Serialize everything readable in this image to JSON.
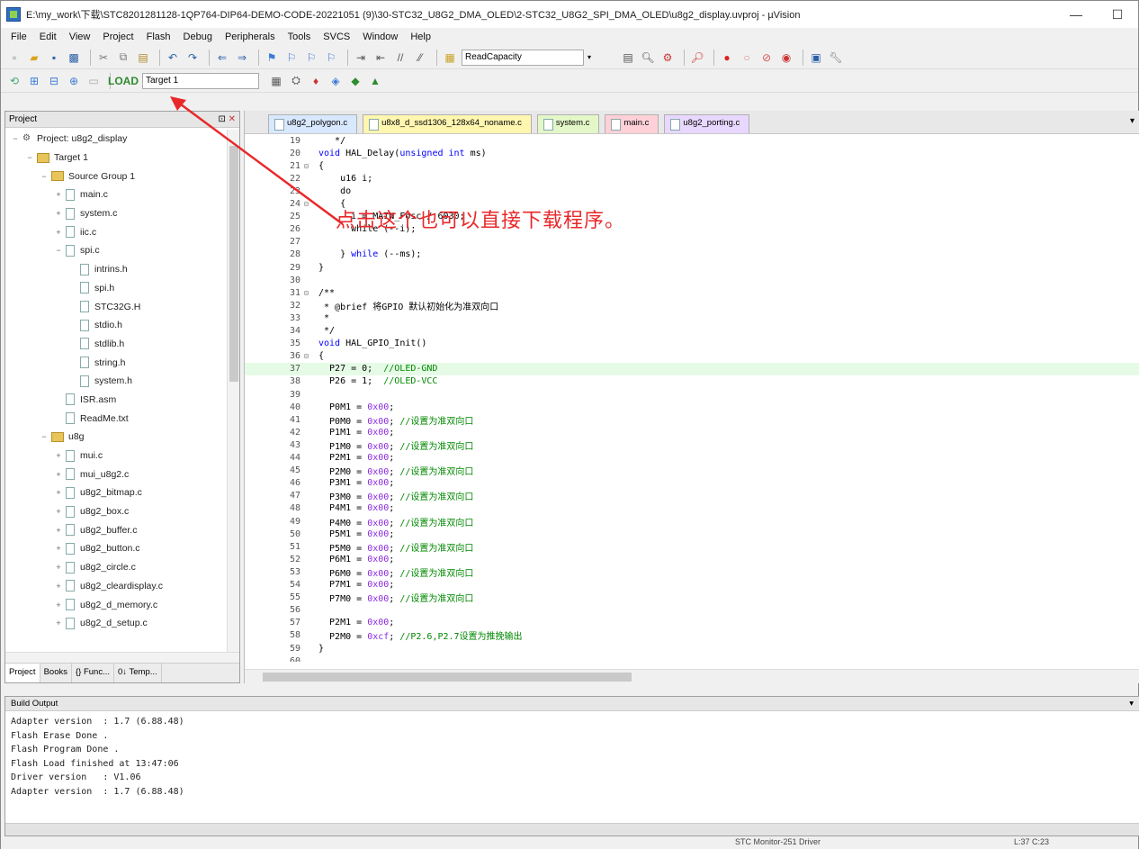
{
  "window": {
    "title": "E:\\my_work\\下载\\STC8201281128-1QP764-DIP64-DEMO-CODE-20221051 (9)\\30-STC32_U8G2_DMA_OLED\\2-STC32_U8G2_SPI_DMA_OLED\\u8g2_display.uvproj - µVision",
    "minimize": "—",
    "maximize": "☐"
  },
  "menu": [
    "File",
    "Edit",
    "View",
    "Project",
    "Flash",
    "Debug",
    "Peripherals",
    "Tools",
    "SVCS",
    "Window",
    "Help"
  ],
  "toolbar": {
    "find_combo": "ReadCapacity",
    "target_combo": "Target 1"
  },
  "project": {
    "header": "Project",
    "tree": [
      {
        "depth": 0,
        "exp": "−",
        "icon": "proj",
        "label": "Project: u8g2_display"
      },
      {
        "depth": 1,
        "exp": "−",
        "icon": "folder",
        "label": "Target 1"
      },
      {
        "depth": 2,
        "exp": "−",
        "icon": "folder",
        "label": "Source Group 1"
      },
      {
        "depth": 3,
        "exp": "+",
        "icon": "file",
        "label": "main.c"
      },
      {
        "depth": 3,
        "exp": "+",
        "icon": "file",
        "label": "system.c"
      },
      {
        "depth": 3,
        "exp": "+",
        "icon": "file",
        "label": "iic.c"
      },
      {
        "depth": 3,
        "exp": "−",
        "icon": "file",
        "label": "spi.c"
      },
      {
        "depth": 4,
        "exp": "",
        "icon": "file",
        "label": "intrins.h"
      },
      {
        "depth": 4,
        "exp": "",
        "icon": "file",
        "label": "spi.h"
      },
      {
        "depth": 4,
        "exp": "",
        "icon": "file",
        "label": "STC32G.H"
      },
      {
        "depth": 4,
        "exp": "",
        "icon": "file",
        "label": "stdio.h"
      },
      {
        "depth": 4,
        "exp": "",
        "icon": "file",
        "label": "stdlib.h"
      },
      {
        "depth": 4,
        "exp": "",
        "icon": "file",
        "label": "string.h"
      },
      {
        "depth": 4,
        "exp": "",
        "icon": "file",
        "label": "system.h"
      },
      {
        "depth": 3,
        "exp": "",
        "icon": "file",
        "label": "ISR.asm"
      },
      {
        "depth": 3,
        "exp": "",
        "icon": "file",
        "label": "ReadMe.txt"
      },
      {
        "depth": 2,
        "exp": "−",
        "icon": "folder",
        "label": "u8g"
      },
      {
        "depth": 3,
        "exp": "+",
        "icon": "file",
        "label": "mui.c"
      },
      {
        "depth": 3,
        "exp": "+",
        "icon": "file",
        "label": "mui_u8g2.c"
      },
      {
        "depth": 3,
        "exp": "+",
        "icon": "file",
        "label": "u8g2_bitmap.c"
      },
      {
        "depth": 3,
        "exp": "+",
        "icon": "file",
        "label": "u8g2_box.c"
      },
      {
        "depth": 3,
        "exp": "+",
        "icon": "file",
        "label": "u8g2_buffer.c"
      },
      {
        "depth": 3,
        "exp": "+",
        "icon": "file",
        "label": "u8g2_button.c"
      },
      {
        "depth": 3,
        "exp": "+",
        "icon": "file",
        "label": "u8g2_circle.c"
      },
      {
        "depth": 3,
        "exp": "+",
        "icon": "file",
        "label": "u8g2_cleardisplay.c"
      },
      {
        "depth": 3,
        "exp": "+",
        "icon": "file",
        "label": "u8g2_d_memory.c"
      },
      {
        "depth": 3,
        "exp": "+",
        "icon": "file",
        "label": "u8g2_d_setup.c"
      }
    ],
    "tabs": [
      "Project",
      "Books",
      "{} Func...",
      "0↓ Temp..."
    ]
  },
  "editor": {
    "tabs": [
      {
        "label": "u8g2_polygon.c",
        "color": "#d8e8ff"
      },
      {
        "label": "u8x8_d_ssd1306_128x64_noname.c",
        "color": "#fff6b0"
      },
      {
        "label": "system.c",
        "color": "#e4f7c8"
      },
      {
        "label": "main.c",
        "color": "#ffd0d8"
      },
      {
        "label": "u8g2_porting.c",
        "color": "#e8d8ff"
      }
    ],
    "lines": [
      {
        "n": "19",
        "fold": "",
        "html": "   */"
      },
      {
        "n": "20",
        "fold": "",
        "html": "<span class='kw'>void</span> HAL_Delay(<span class='kw'>unsigned int</span> ms)"
      },
      {
        "n": "21",
        "fold": "⊟",
        "html": "{"
      },
      {
        "n": "22",
        "fold": "",
        "html": "    u16 i;"
      },
      {
        "n": "23",
        "fold": "",
        "html": "    do"
      },
      {
        "n": "24",
        "fold": "⊟",
        "html": "    {"
      },
      {
        "n": "25",
        "fold": "",
        "html": "      i = MAIN_Fosc / 6030;"
      },
      {
        "n": "26",
        "fold": "",
        "html": "      while (--i);"
      },
      {
        "n": "27",
        "fold": "",
        "html": ""
      },
      {
        "n": "28",
        "fold": "",
        "html": "    } <span class='kw'>while</span> (--ms);"
      },
      {
        "n": "29",
        "fold": "",
        "html": "}"
      },
      {
        "n": "30",
        "fold": "",
        "html": ""
      },
      {
        "n": "31",
        "fold": "⊟",
        "html": "/**"
      },
      {
        "n": "32",
        "fold": "",
        "html": " * @brief 将GPIO 默认初始化为准双向口"
      },
      {
        "n": "33",
        "fold": "",
        "html": " *"
      },
      {
        "n": "34",
        "fold": "",
        "html": " */"
      },
      {
        "n": "35",
        "fold": "",
        "html": "<span class='kw'>void</span> HAL_GPIO_Init()"
      },
      {
        "n": "36",
        "fold": "⊟",
        "html": "{"
      },
      {
        "n": "37",
        "fold": "",
        "html": "  P27 = 0;  <span class='cm'>//OLED-GND</span>",
        "hl": true
      },
      {
        "n": "38",
        "fold": "",
        "html": "  P26 = 1;  <span class='cm'>//OLED-VCC</span>"
      },
      {
        "n": "39",
        "fold": "",
        "html": ""
      },
      {
        "n": "40",
        "fold": "",
        "html": "  P0M1 = <span class='hex'>0x00</span>;"
      },
      {
        "n": "41",
        "fold": "",
        "html": "  P0M0 = <span class='hex'>0x00</span>; <span class='cm'>//设置为准双向口</span>"
      },
      {
        "n": "42",
        "fold": "",
        "html": "  P1M1 = <span class='hex'>0x00</span>;"
      },
      {
        "n": "43",
        "fold": "",
        "html": "  P1M0 = <span class='hex'>0x00</span>; <span class='cm'>//设置为准双向口</span>"
      },
      {
        "n": "44",
        "fold": "",
        "html": "  P2M1 = <span class='hex'>0x00</span>;"
      },
      {
        "n": "45",
        "fold": "",
        "html": "  P2M0 = <span class='hex'>0x00</span>; <span class='cm'>//设置为准双向口</span>"
      },
      {
        "n": "46",
        "fold": "",
        "html": "  P3M1 = <span class='hex'>0x00</span>;"
      },
      {
        "n": "47",
        "fold": "",
        "html": "  P3M0 = <span class='hex'>0x00</span>; <span class='cm'>//设置为准双向口</span>"
      },
      {
        "n": "48",
        "fold": "",
        "html": "  P4M1 = <span class='hex'>0x00</span>;"
      },
      {
        "n": "49",
        "fold": "",
        "html": "  P4M0 = <span class='hex'>0x00</span>; <span class='cm'>//设置为准双向口</span>"
      },
      {
        "n": "50",
        "fold": "",
        "html": "  P5M1 = <span class='hex'>0x00</span>;"
      },
      {
        "n": "51",
        "fold": "",
        "html": "  P5M0 = <span class='hex'>0x00</span>; <span class='cm'>//设置为准双向口</span>"
      },
      {
        "n": "52",
        "fold": "",
        "html": "  P6M1 = <span class='hex'>0x00</span>;"
      },
      {
        "n": "53",
        "fold": "",
        "html": "  P6M0 = <span class='hex'>0x00</span>; <span class='cm'>//设置为准双向口</span>"
      },
      {
        "n": "54",
        "fold": "",
        "html": "  P7M1 = <span class='hex'>0x00</span>;"
      },
      {
        "n": "55",
        "fold": "",
        "html": "  P7M0 = <span class='hex'>0x00</span>; <span class='cm'>//设置为准双向口</span>"
      },
      {
        "n": "56",
        "fold": "",
        "html": ""
      },
      {
        "n": "57",
        "fold": "",
        "html": "  P2M1 = <span class='hex'>0x00</span>;"
      },
      {
        "n": "58",
        "fold": "",
        "html": "  P2M0 = <span class='hex'>0xcf</span>; <span class='cm'>//P2.6,P2.7设置为推挽输出</span>"
      },
      {
        "n": "59",
        "fold": "",
        "html": "}"
      },
      {
        "n": "60",
        "fold": "",
        "html": ""
      }
    ]
  },
  "annotation": {
    "text": "点击这个也可以直接下载程序。",
    "color": "#e8282a"
  },
  "build": {
    "header": "Build Output",
    "lines": [
      "Adapter version  : 1.7 (6.88.48)",
      "Flash Erase Done .",
      "Flash Program Done .",
      "Flash Load finished at 13:47:06",
      "Driver version   : V1.06",
      "Adapter version  : 1.7 (6.88.48)"
    ]
  },
  "status": {
    "debugger": "STC Monitor-251 Driver",
    "position": "L:37 C:23"
  }
}
